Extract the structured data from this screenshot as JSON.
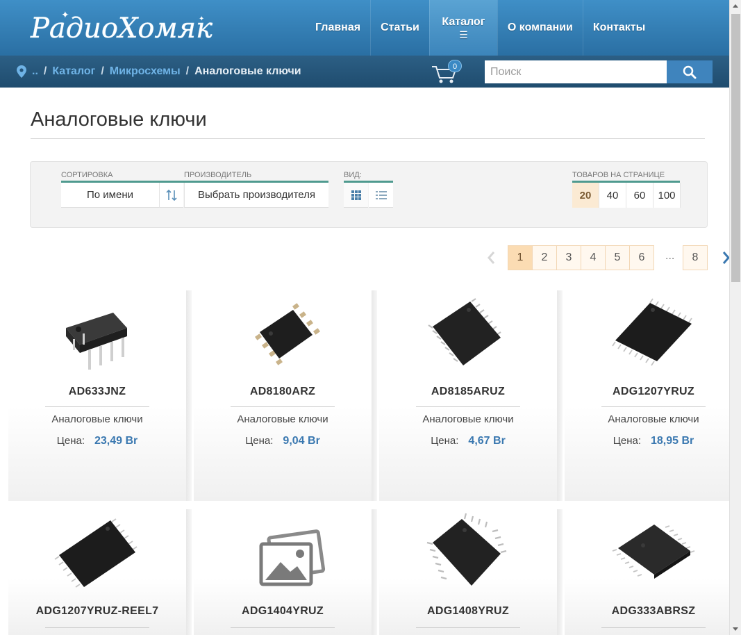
{
  "header": {
    "logo_text": "РадиоХомяк",
    "nav": [
      {
        "label": "Главная"
      },
      {
        "label": "Статьи"
      },
      {
        "label": "Каталог",
        "icon": "☰"
      },
      {
        "label": "О компании"
      },
      {
        "label": "Контакты"
      }
    ]
  },
  "breadcrumb": {
    "items": [
      "..",
      "Каталог",
      "Микросхемы"
    ],
    "separator": "/",
    "current": "Аналоговые ключи"
  },
  "cart": {
    "count": "0"
  },
  "search": {
    "placeholder": "Поиск"
  },
  "page": {
    "title": "Аналоговые ключи"
  },
  "filters": {
    "sort_label": "СОРТИРОВКА",
    "sort_value": "По имени",
    "manufacturer_label": "ПРОИЗВОДИТЕЛЬ",
    "manufacturer_value": "Выбрать производителя",
    "view_label": "ВИД:",
    "perpage_label": "ТОВАРОВ НА СТРАНИЦЕ",
    "perpage_options": [
      "20",
      "40",
      "60",
      "100"
    ],
    "perpage_selected": "20"
  },
  "pagination": {
    "pages": [
      "1",
      "2",
      "3",
      "4",
      "5",
      "6"
    ],
    "ellipsis": "...",
    "last": "8",
    "current": "1"
  },
  "products": [
    {
      "name": "AD633JNZ",
      "category": "Аналоговые ключи",
      "price_label": "Цена:",
      "price": "23,49 Br",
      "image": "dip-chip"
    },
    {
      "name": "AD8180ARZ",
      "category": "Аналоговые ключи",
      "price_label": "Цена:",
      "price": "9,04 Br",
      "image": "soic8-chip"
    },
    {
      "name": "AD8185ARUZ",
      "category": "Аналоговые ключи",
      "price_label": "Цена:",
      "price": "4,67 Br",
      "image": "tssop-chip"
    },
    {
      "name": "ADG1207YRUZ",
      "category": "Аналоговые ключи",
      "price_label": "Цена:",
      "price": "18,95 Br",
      "image": "tssop-long-chip"
    },
    {
      "name": "ADG1207YRUZ-REEL7",
      "image": "tssop-long-chip"
    },
    {
      "name": "ADG1404YRUZ",
      "image": "placeholder-photo"
    },
    {
      "name": "ADG1408YRUZ",
      "image": "tssop-chip"
    },
    {
      "name": "ADG333ABRSZ",
      "image": "ssop-chip"
    }
  ],
  "colors": {
    "header_top": "#3f8fc7",
    "header_bar": "#2c5f85",
    "link": "#6fb3e6",
    "price": "#3a78b0",
    "accent_green": "#4f9a8f",
    "pager_active": "#fbdcb3"
  }
}
